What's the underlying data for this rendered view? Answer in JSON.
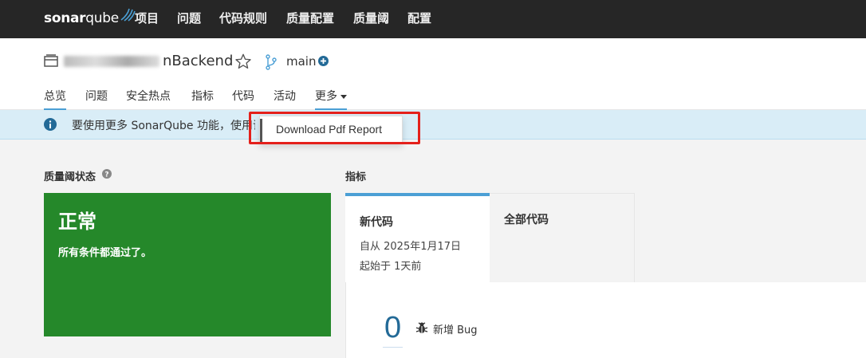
{
  "app": {
    "logo_text_bold": "sonar",
    "logo_text": "qube"
  },
  "topnav": {
    "items": [
      "项目",
      "问题",
      "代码规则",
      "质量配置",
      "质量阈",
      "配置"
    ]
  },
  "project": {
    "name_visible": "nBackend",
    "branch": "main"
  },
  "tabs": {
    "items": [
      "总览",
      "问题",
      "安全热点",
      "指标",
      "代码",
      "活动"
    ],
    "more": "更多",
    "active": "总览"
  },
  "banner": {
    "text": "要使用更多 SonarQube 功能，使用证"
  },
  "dropdown": {
    "item": "Download Pdf Report"
  },
  "quality_gate": {
    "title": "质量阈状态",
    "status": "正常",
    "message": "所有条件都通过了。",
    "color": "#25882a"
  },
  "measures": {
    "title": "指标",
    "tab_new": "新代码",
    "tab_all": "全部代码",
    "since": "自从 2025年1月17日",
    "started": "起始于 1天前",
    "new_bugs_value": "0",
    "new_bugs_label": "新增 Bug"
  },
  "colors": {
    "accent": "#4b9fd5",
    "highlight": "#e4201b",
    "topnav_bg": "#262626"
  }
}
